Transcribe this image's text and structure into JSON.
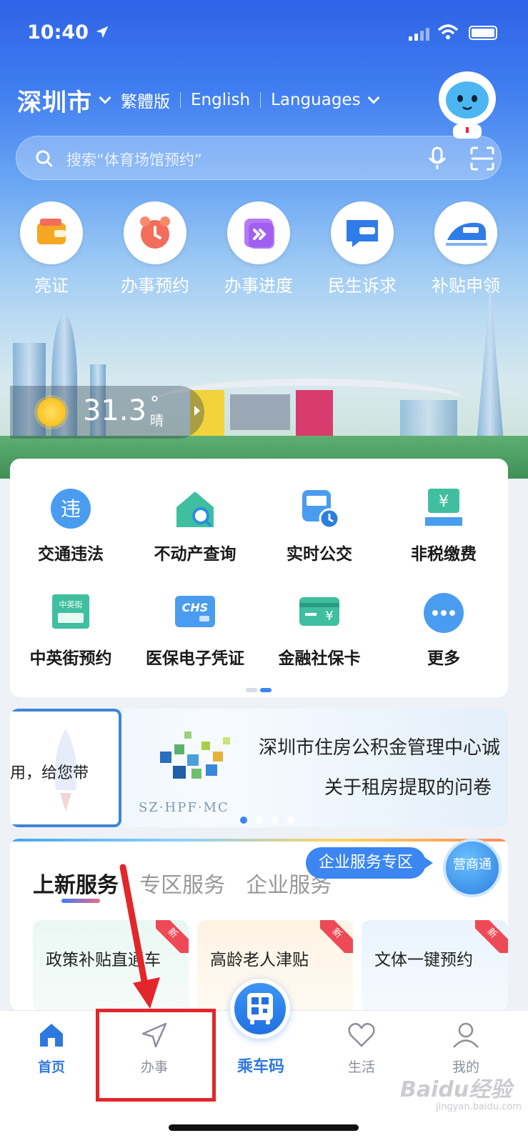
{
  "status_bar": {
    "time": "10:40"
  },
  "header": {
    "city": "深圳市",
    "lang_traditional": "繁體版",
    "lang_english": "English",
    "lang_languages": "Languages"
  },
  "search": {
    "placeholder": "搜索“体育场馆预约”"
  },
  "quick_actions": [
    {
      "label": "亮证",
      "icon": "wallet-icon"
    },
    {
      "label": "办事预约",
      "icon": "alarm-clock-icon"
    },
    {
      "label": "办事进度",
      "icon": "progress-arrows-icon"
    },
    {
      "label": "民生诉求",
      "icon": "speech-bubble-icon"
    },
    {
      "label": "补贴申领",
      "icon": "train-icon"
    }
  ],
  "weather": {
    "temperature": "31.3",
    "degree": "°",
    "condition": "晴"
  },
  "services": [
    {
      "label": "交通违法",
      "icon": "traffic-violation-icon"
    },
    {
      "label": "不动产查询",
      "icon": "house-search-icon"
    },
    {
      "label": "实时公交",
      "icon": "bus-clock-icon"
    },
    {
      "label": "非税缴费",
      "icon": "yuan-payment-icon"
    },
    {
      "label": "中英街预约",
      "icon": "street-sign-icon"
    },
    {
      "label": "医保电子凭证",
      "icon": "chs-card-icon"
    },
    {
      "label": "金融社保卡",
      "icon": "yuan-card-icon"
    },
    {
      "label": "更多",
      "icon": "more-dots-icon"
    }
  ],
  "service_icon_text": {
    "wei": "违",
    "zyj": "中英街",
    "chs": "CHS"
  },
  "banner": {
    "left_text": "用，给您带",
    "line1": "深圳市住房公积金管理中心诚",
    "line2": "关于租房提取的问卷",
    "logo_text": "SZ·HPF·MC"
  },
  "new_services": {
    "tabs": [
      "上新服务",
      "专区服务",
      "企业服务"
    ],
    "enterprise_bubble": "企业服务专区",
    "yst_label": "营商通",
    "badge": "新",
    "cards": [
      "政策补贴直通车",
      "高龄老人津贴",
      "文体一键预约"
    ]
  },
  "tab_bar": {
    "home": "首页",
    "affairs": "办事",
    "ride": "乘车码",
    "life": "生活",
    "mine": "我的"
  },
  "watermark": {
    "brand": "Baidu经验",
    "url": "jingyan.baidu.com"
  },
  "colors": {
    "primary": "#2f78e0",
    "annotation": "#e3262b"
  }
}
